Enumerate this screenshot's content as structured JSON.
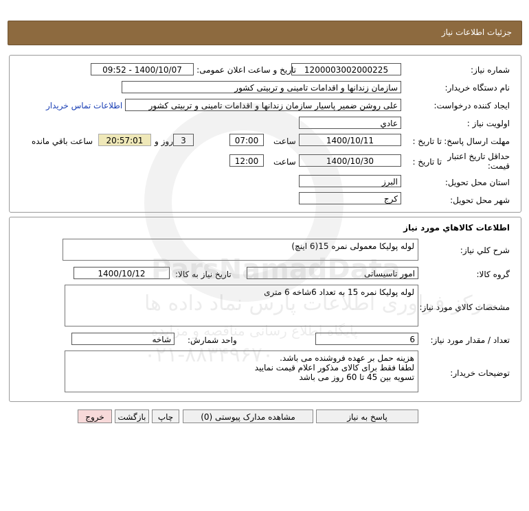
{
  "header": {
    "title": "جزئیات اطلاعات نیاز"
  },
  "info": {
    "need_number_label": "شماره نیاز:",
    "need_number": "1200003002000225",
    "announce_label": "تاریخ و ساعت اعلان عمومی:",
    "announce_value": "1400/10/07 - 09:52",
    "buyer_label": "نام دستگاه خریدار:",
    "buyer_value": "سازمان زندانها و اقدامات تامینی و تربیتی کشور",
    "creator_label": "ایجاد کننده درخواست:",
    "creator_value": "علی روشن ضمیر پاسیار سازمان زندانها و اقدامات تامینی و تربیتی کشور",
    "contact_link": "اطلاعات تماس خریدار",
    "priority_label": "اولویت نیاز :",
    "priority_value": "عادي",
    "deadline_label": "مهلت ارسال پاسخ:",
    "to_date_label": "تا تاریخ :",
    "deadline_date": "1400/10/11",
    "time_label": "ساعت",
    "deadline_time": "07:00",
    "days_value": "3",
    "days_label": "روز و",
    "remaining_time": "20:57:01",
    "remaining_label": "ساعت باقي مانده",
    "validity_label_1": "حداقل تاریخ اعتبار",
    "validity_label_2": "قیمت:",
    "validity_date": "1400/10/30",
    "validity_time": "12:00",
    "province_label": "استان محل تحویل:",
    "province_value": "البرز",
    "city_label": "شهر محل تحویل:",
    "city_value": "کرج"
  },
  "goods": {
    "section_title": "اطلاعات کالاهاي مورد نياز",
    "desc_label": "شرح کلي نياز:",
    "desc_value": "لوله پولیکا معمولی نمره 15(6 اینچ)",
    "group_label": "گروه کالا:",
    "group_value": "امور تاسیساتی",
    "need_date_label": "تاریخ نیاز به کالا:",
    "need_date_value": "1400/10/12",
    "spec_label": "مشخصات کالاي مورد نياز:",
    "spec_value": "لوله پولیکا نمره 15 به تعداد 6شاخه 6 متری",
    "qty_label": "تعداد / مقدار مورد نیاز:",
    "qty_value": "6",
    "unit_label": "واحد شمارش:",
    "unit_value": "شاخه",
    "buyer_notes_label": "توضیحات خریدار:",
    "buyer_notes": [
      "هزینه حمل بر عهده فروشنده می باشد.",
      "لطفا فقط برای کالای مذکور اعلام قیمت نمایید",
      "تسویه بین 45 تا 60 روز می باشد"
    ]
  },
  "buttons": {
    "respond": "پاسخ به نیاز",
    "attachments": "مشاهده مدارک پیوستی (0)",
    "print": "چاپ",
    "back": "بازگشت",
    "exit": "خروج"
  },
  "watermark": {
    "brand": "ParsNamadData",
    "line1": "مرکز فراوری اطلاعات پارس نماد داده ها",
    "line2": "پایگاه اطلاع رسانی مناقصه و مزایده",
    "phone": "۰۲۱-۸۸۳۴۹۶۷۰"
  },
  "colors": {
    "header_bg": "#8d6a3f",
    "remaining_bg": "#efe8b8",
    "exit_bg": "#f7d9d9",
    "link": "#1a3fb5"
  }
}
